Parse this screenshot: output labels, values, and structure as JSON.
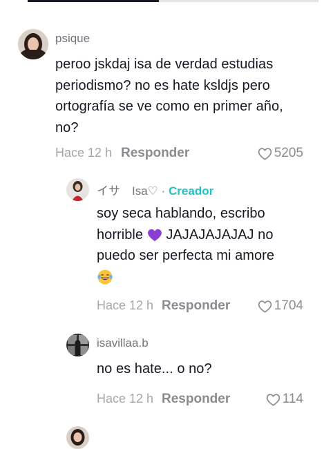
{
  "comments": [
    {
      "username": "psique",
      "lines": [
        "peroo jskdaj isa de verdad estudias",
        "periodismo? no es hate ksldjs pero",
        "ortografía se ve como en primer año,",
        "no?"
      ],
      "time": "Hace 12 h",
      "reply_label": "Responder",
      "likes": "5205"
    }
  ],
  "replies": [
    {
      "username": "イサ　Isa♡",
      "separator": " · ",
      "creator_label": "Creador",
      "line1": "soy seca hablando, escribo",
      "line2_prefix": "horrible",
      "line2_suffix": " JAJAJAJAJAJ no",
      "line3": "puedo ser perfecta mi amore",
      "time": "Hace 12 h",
      "reply_label": "Responder",
      "likes": "1704",
      "emoji_names": [
        "purple-heart-emoji",
        "laughing-tears-emoji"
      ]
    },
    {
      "username": "isavillaa.b",
      "lines": [
        "no es hate... o no?"
      ],
      "time": "Hace 12 h",
      "reply_label": "Responder",
      "likes": "114"
    }
  ],
  "colors": {
    "creator_accent": "#20c0c8",
    "text": "#161823",
    "meta": "#a5a6ab"
  },
  "icons": [
    "heart-outline-icon"
  ]
}
